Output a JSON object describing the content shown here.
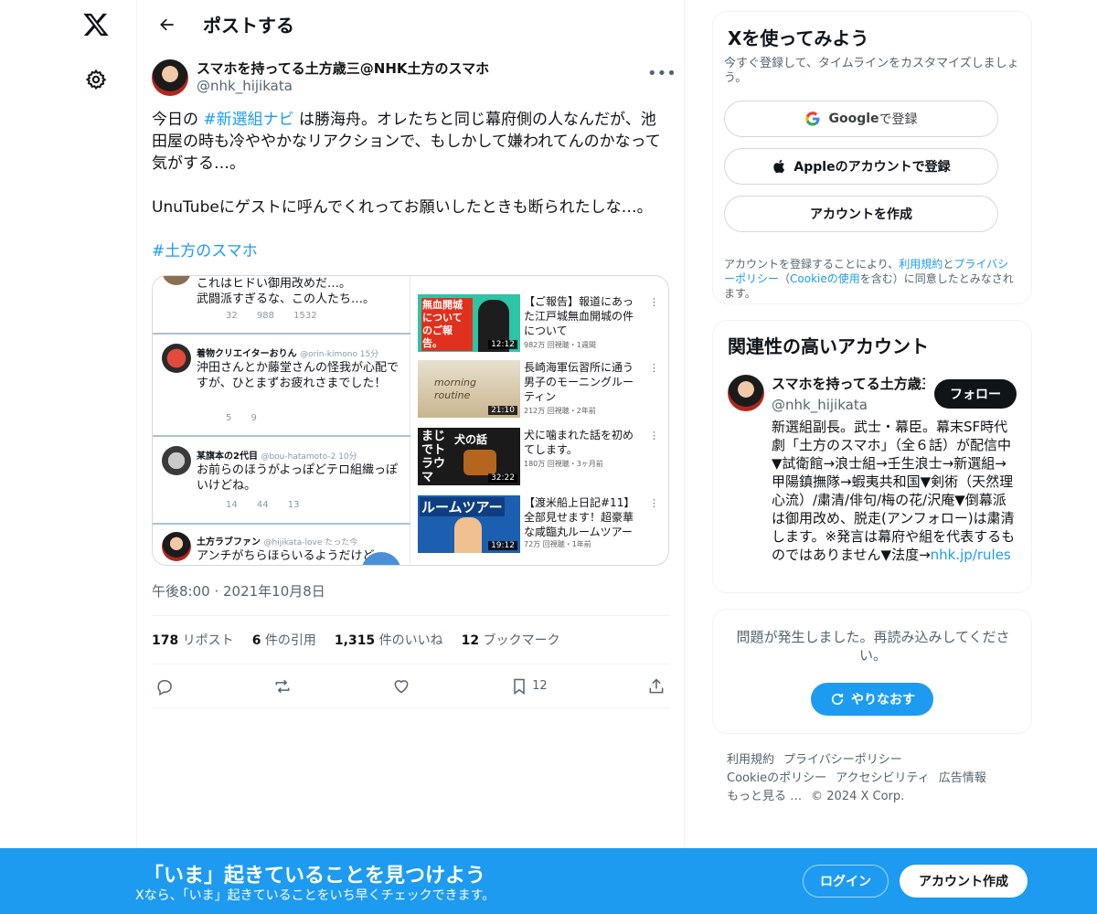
{
  "nav": {
    "logo": "x-logo-icon",
    "settings": "gear-icon"
  },
  "header": {
    "title": "ポストする"
  },
  "post": {
    "display_name": "スマホを持ってる土方歳三@NHK土方のスマホ",
    "handle": "@nhk_hijikata",
    "text_before": "今日の ",
    "hashtag1": "#新選組ナビ",
    "text_after": " は勝海舟。オレたちと同じ幕府側の人なんだが、池田屋の時も冷ややかなリアクションで、もしかして嫌われてんのかなって気がする…。\n\nUnuTubeにゲストに呼んでくれってお願いしたときも断られたしな…。\n\n",
    "hashtag2": "#土方のスマホ",
    "timestamp": "午後8:00 · 2021年10月8日",
    "stats": {
      "reposts_num": "178",
      "reposts_label": "リポスト",
      "quotes_num": "6",
      "quotes_label": "件の引用",
      "likes_num": "1,315",
      "likes_label": "件のいいね",
      "bookmarks_num": "12",
      "bookmarks_label": "ブックマーク"
    },
    "bookmark_count": "12"
  },
  "media": {
    "tweets": [
      {
        "body": "これはヒドい御用改めだ…。\n武闘派すぎるな、この人たち…。",
        "actions": "32 988 1532"
      },
      {
        "name": "着物クリエイターおりん",
        "sub": "@orin-kimono 15分",
        "body": "沖田さんとか藤堂さんの怪我が心配ですが、ひとまずお疲れさまでした！",
        "actions": "5 9"
      },
      {
        "name": "某旗本の2代目",
        "sub": "@bou-hatamoto-2 10分",
        "body": "お前らのほうがよっぽどテロ組織っぽいけどね。",
        "actions": "14 44 13"
      },
      {
        "name": "土方ラブファン",
        "sub": "@hijikata-love たった今",
        "body": "アンチがちらほらいるようだけど"
      }
    ],
    "videos": [
      {
        "thumb_text": "無血開城についてのご報告。",
        "duration": "12:12",
        "title": "【ご報告】報道にあった江戸城無血開城の件について",
        "meta": "982万 回視聴・1週間"
      },
      {
        "thumb_text": "morning routine",
        "duration": "21:10",
        "title": "長崎海軍伝習所に通う男子のモーニングルーティン",
        "meta": "212万 回視聴・2年前"
      },
      {
        "thumb_text": "まじでトラウマ",
        "thumb_text2": "犬の話",
        "duration": "32:22",
        "title": "犬に噛まれた話を初めてします。",
        "meta": "180万 回視聴・3ヶ月前"
      },
      {
        "thumb_text": "ルームツアー",
        "duration": "19:12",
        "title": "【渡米船上日記#11】全部見せます！超豪華な咸臨丸ルームツアー",
        "meta": "72万 回視聴・1年前"
      }
    ]
  },
  "signup": {
    "title": "Xを使ってみよう",
    "subtitle": "今すぐ登録して、タイムラインをカスタマイズしましょう。",
    "google_brand": "Google",
    "google_label": " で登録",
    "apple_label": "Appleのアカウントで登録",
    "create_label": "アカウントを作成",
    "terms_before": "アカウントを登録することにより、",
    "terms_link1": "利用規約",
    "terms_and": "と",
    "terms_link2": "プライバシーポリシー",
    "terms_mid": "（",
    "terms_link3": "Cookieの使用",
    "terms_after": "を含む）に同意したとみなされます。"
  },
  "related": {
    "title": "関連性の高いアカウント",
    "name": "スマホを持ってる土方歳三@NHK土方のスマホ",
    "handle": "@nhk_hijikata",
    "follow_label": "フォロー",
    "bio": "新選組副長。武士・幕臣。幕末SF時代劇「土方のスマホ」（全６話）が配信中▼試衛館→浪士組→壬生浪士→新選組→甲陽鎮撫隊→蝦夷共和国▼剣術（天然理心流）/粛清/俳句/梅の花/沢庵▼倒幕派は御用改め、脱走(アンフォロー)は粛清します。※発言は幕府や組を代表するものではありません▼法度→",
    "bio_link": "nhk.jp/rules"
  },
  "error": {
    "text": "問題が発生しました。再読み込みしてください。",
    "retry_label": "やりなおす"
  },
  "footer": {
    "links": [
      "利用規約",
      "プライバシーポリシー",
      "Cookieのポリシー",
      "アクセシビリティ",
      "広告情報",
      "もっと見る …",
      "© 2024 X Corp."
    ]
  },
  "bottom_bar": {
    "title": "「いま」起きていることを見つけよう",
    "subtitle": "Xなら、「いま」起きていることをいち早くチェックできます。",
    "login_label": "ログイン",
    "signup_label": "アカウント作成"
  }
}
